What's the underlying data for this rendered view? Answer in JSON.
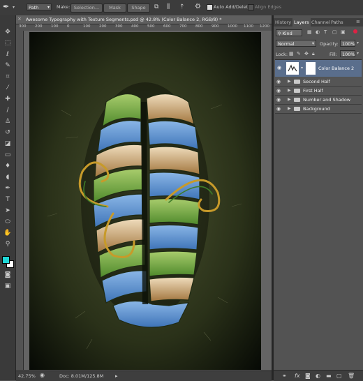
{
  "options_bar": {
    "tool_icon": "pen-tool-icon",
    "mode_value": "Path",
    "make_label": "Make:",
    "selection_button": "Selection...",
    "mask_button": "Mask",
    "shape_button": "Shape",
    "auto_add_delete_label": "Auto Add/Delete",
    "auto_add_delete_checked": true,
    "align_edges_label": "Align Edges",
    "align_edges_checked": false
  },
  "document": {
    "title": "Awesome Typography with Texture Segments.psd @ 42.8% (Color Balance 2, RGB/8) *",
    "ruler_ticks": [
      "300",
      "200",
      "100",
      "0",
      "100",
      "200",
      "300",
      "400",
      "500",
      "600",
      "700",
      "800",
      "900",
      "1000",
      "1100",
      "1200",
      "1300"
    ]
  },
  "status_bar": {
    "zoom": "42.75%",
    "doc_info": "Doc: 8.01M/125.8M"
  },
  "panel_tabs": [
    "History",
    "Layers",
    "Channel",
    "Paths"
  ],
  "active_panel_tab": "Layers",
  "layers_panel": {
    "filter_value": "Kind",
    "blend_mode": "Normal",
    "opacity_label": "Opacity:",
    "opacity_value": "100%",
    "lock_label": "Lock:",
    "fill_label": "Fill:",
    "fill_value": "100%",
    "layers": [
      {
        "name": "Color Balance 2",
        "type": "adjustment",
        "selected": true
      },
      {
        "name": "Second Half",
        "type": "group"
      },
      {
        "name": "First Half",
        "type": "group"
      },
      {
        "name": "Number and Shadow",
        "type": "group"
      },
      {
        "name": "Background",
        "type": "group"
      }
    ]
  },
  "colors": {
    "foreground": "#1fd6d6",
    "background": "#ffffff",
    "selection": "#5a6e8c"
  }
}
